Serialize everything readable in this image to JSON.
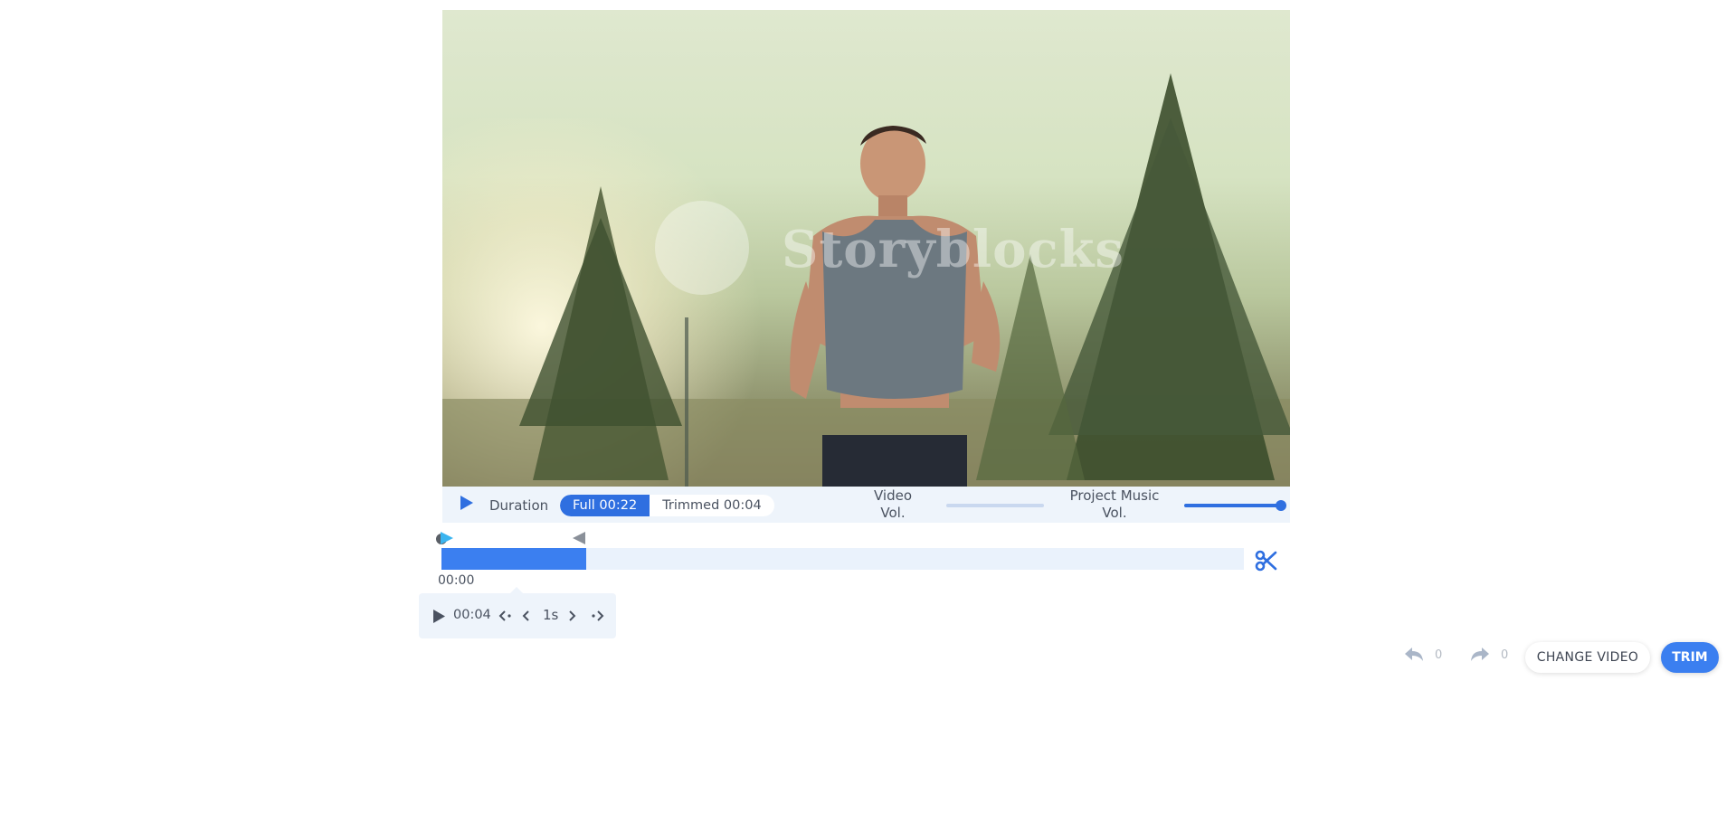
{
  "video": {
    "watermark": "Storyblocks"
  },
  "player": {
    "duration_label": "Duration",
    "full_label": "Full 00:22",
    "trimmed_label": "Trimmed 00:04",
    "selected_mode": "full",
    "video_vol_label": "Video Vol.",
    "video_volume": 0.0,
    "music_vol_label": "Project Music Vol.",
    "music_volume": 1.0
  },
  "timeline": {
    "selection_fraction": 0.18,
    "start_time": "00:00"
  },
  "popover": {
    "time": "00:04",
    "step": "1s"
  },
  "actions": {
    "undo_count": "0",
    "redo_count": "0",
    "change_video_label": "CHANGE VIDEO",
    "trim_label": "TRIM"
  },
  "colors": {
    "accent": "#3b7ff0",
    "accent_dark": "#2f6fe0",
    "panel_bg": "#eef4fb",
    "text": "#4a5260"
  },
  "icons": [
    "play-icon",
    "scissors-icon",
    "jump-start-icon",
    "step-back-icon",
    "step-forward-icon",
    "jump-end-icon",
    "undo-icon",
    "redo-icon"
  ]
}
